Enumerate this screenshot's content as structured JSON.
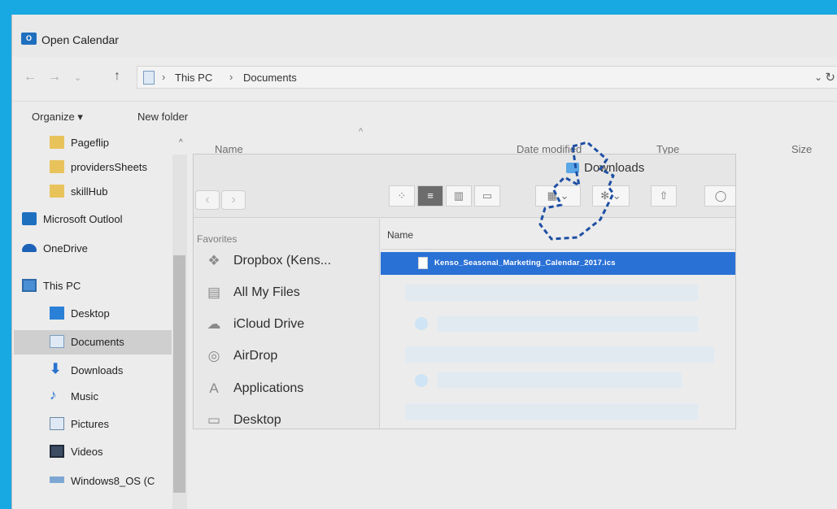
{
  "window": {
    "title": "Open Calendar",
    "title_icon": "outlook-icon"
  },
  "address": {
    "crumbs": [
      "This PC",
      "Documents"
    ],
    "separator": "›"
  },
  "toolbar": {
    "organize_label": "Organize ▾",
    "new_folder_label": "New folder"
  },
  "nav": {
    "items": [
      {
        "label": "Pageflip",
        "icon": "folder-icon"
      },
      {
        "label": "providersSheets",
        "icon": "folder-icon"
      },
      {
        "label": "skillHub",
        "icon": "folder-icon"
      },
      {
        "label": "Microsoft Outlool",
        "icon": "outlook-icon"
      },
      {
        "label": "OneDrive",
        "icon": "cloud-icon"
      },
      {
        "label": "This PC",
        "icon": "computer-icon"
      },
      {
        "label": "Desktop",
        "icon": "desktop-icon"
      },
      {
        "label": "Documents",
        "icon": "documents-icon",
        "selected": true
      },
      {
        "label": "Downloads",
        "icon": "download-icon"
      },
      {
        "label": "Music",
        "icon": "music-icon"
      },
      {
        "label": "Pictures",
        "icon": "pictures-icon"
      },
      {
        "label": "Videos",
        "icon": "videos-icon"
      },
      {
        "label": "Windows8_OS (C",
        "icon": "drive-icon"
      }
    ]
  },
  "columns": {
    "name": "Name",
    "date": "Date modified",
    "type": "Type",
    "size": "Size"
  },
  "mac_dialog": {
    "title": "Downloads",
    "favorites_heading": "Favorites",
    "sidebar": [
      {
        "label": "Dropbox (Kens...",
        "icon": "dropbox-icon"
      },
      {
        "label": "All My Files",
        "icon": "files-icon"
      },
      {
        "label": "iCloud Drive",
        "icon": "icloud-icon"
      },
      {
        "label": "AirDrop",
        "icon": "airdrop-icon"
      },
      {
        "label": "Applications",
        "icon": "applications-icon"
      },
      {
        "label": "Desktop",
        "icon": "desktop-icon"
      }
    ],
    "name_header": "Name",
    "selected_file": "Kenso_Seasonal_Marketing_Calendar_2017.ics"
  },
  "colors": {
    "background": "#18a8e2",
    "selection": "#2a71d6",
    "cursor": "#1e4fa3"
  }
}
